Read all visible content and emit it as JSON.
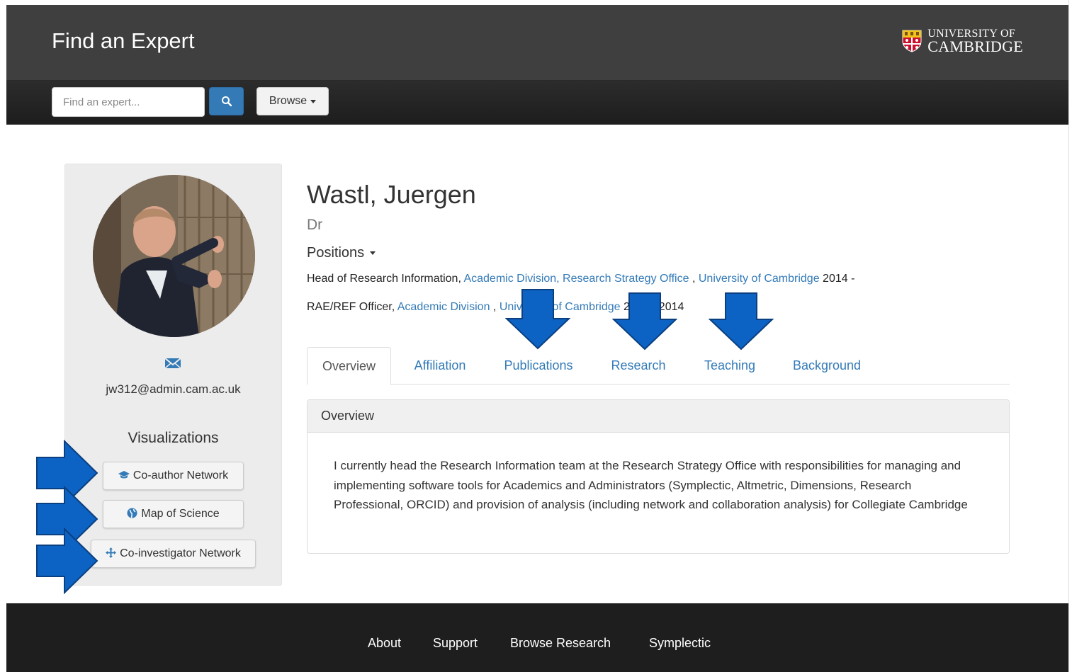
{
  "header": {
    "site_title": "Find an Expert",
    "uni_logo_line1": "UNIVERSITY OF",
    "uni_logo_line2": "CAMBRIDGE"
  },
  "nav": {
    "search_placeholder": "Find an expert...",
    "browse_label": "Browse"
  },
  "sidebar": {
    "email": "jw312@admin.cam.ac.uk",
    "visualizations_heading": "Visualizations",
    "buttons": [
      "Co-author Network",
      "Map of Science",
      "Co-investigator Network"
    ]
  },
  "profile": {
    "name": "Wastl, Juergen",
    "title": "Dr",
    "positions_label": "Positions",
    "positions": [
      {
        "role": "Head of Research Information, ",
        "link1": "Academic Division, Research Strategy Office",
        "sep": " , ",
        "link2": "University of Cambridge",
        "dates": " 2014 -"
      },
      {
        "role": "RAE/REF Officer, ",
        "link1": "Academic Division",
        "sep": " , ",
        "link2": "University of Cambridge",
        "dates": " 2007 - 2014"
      }
    ]
  },
  "tabs": [
    "Overview",
    "Affiliation",
    "Publications",
    "Research",
    "Teaching",
    "Background"
  ],
  "overview": {
    "heading": "Overview",
    "body": "I currently head the Research Information team at the Research Strategy Office with responsibilities for managing and implementing software tools for Academics and Administrators (Symplectic, Altmetric, Dimensions, Research Professional, ORCID) and provision of analysis (including network and collaboration analysis) for Collegiate Cambridge"
  },
  "footer": {
    "links": [
      "About",
      "Support",
      "Browse Research",
      "Symplectic"
    ]
  },
  "colors": {
    "header_bg": "#3f3f3f",
    "nav_bg": "#1d1d1d",
    "link": "#337ab7",
    "arrow": "#0d63c4",
    "footer_bg": "#1e1e1e"
  },
  "icons": [
    "search-icon",
    "envelope-icon",
    "graduation-cap-icon",
    "globe-icon",
    "move-icon",
    "caret-down-icon",
    "cambridge-shield-icon"
  ]
}
